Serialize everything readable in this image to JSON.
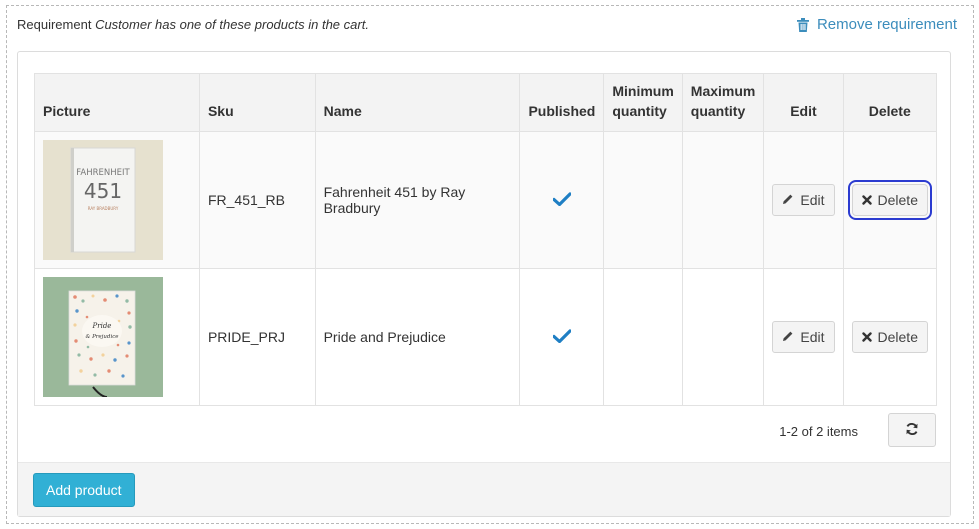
{
  "requirement": {
    "label": "Requirement",
    "description": "Customer has one of these products in the cart.",
    "remove_label": "Remove requirement"
  },
  "table": {
    "headers": {
      "picture": "Picture",
      "sku": "Sku",
      "name": "Name",
      "published": "Published",
      "min_qty_1": "Minimum",
      "min_qty_2": "quantity",
      "max_qty_1": "Maximum",
      "max_qty_2": "quantity",
      "edit": "Edit",
      "delete": "Delete"
    },
    "rows": [
      {
        "sku": "FR_451_RB",
        "name": "Fahrenheit 451 by Ray Bradbury",
        "published": true,
        "min_qty": "",
        "max_qty": "",
        "edit_label": "Edit",
        "delete_label": "Delete",
        "book_title_line1": "FAHRENHEIT",
        "book_title_line2": "451",
        "book_author": "RAY BRADBURY"
      },
      {
        "sku": "PRIDE_PRJ",
        "name": "Pride and Prejudice",
        "published": true,
        "min_qty": "",
        "max_qty": "",
        "edit_label": "Edit",
        "delete_label": "Delete",
        "book_title_line1": "Pride",
        "book_title_line2": "& Prejudice"
      }
    ]
  },
  "pager": {
    "info": "1-2 of 2 items"
  },
  "footer": {
    "add_label": "Add product"
  },
  "colors": {
    "accent": "#3c8dbc",
    "add_button": "#31b0d5",
    "check": "#1f7fc4",
    "focus": "#2b3bd0"
  }
}
